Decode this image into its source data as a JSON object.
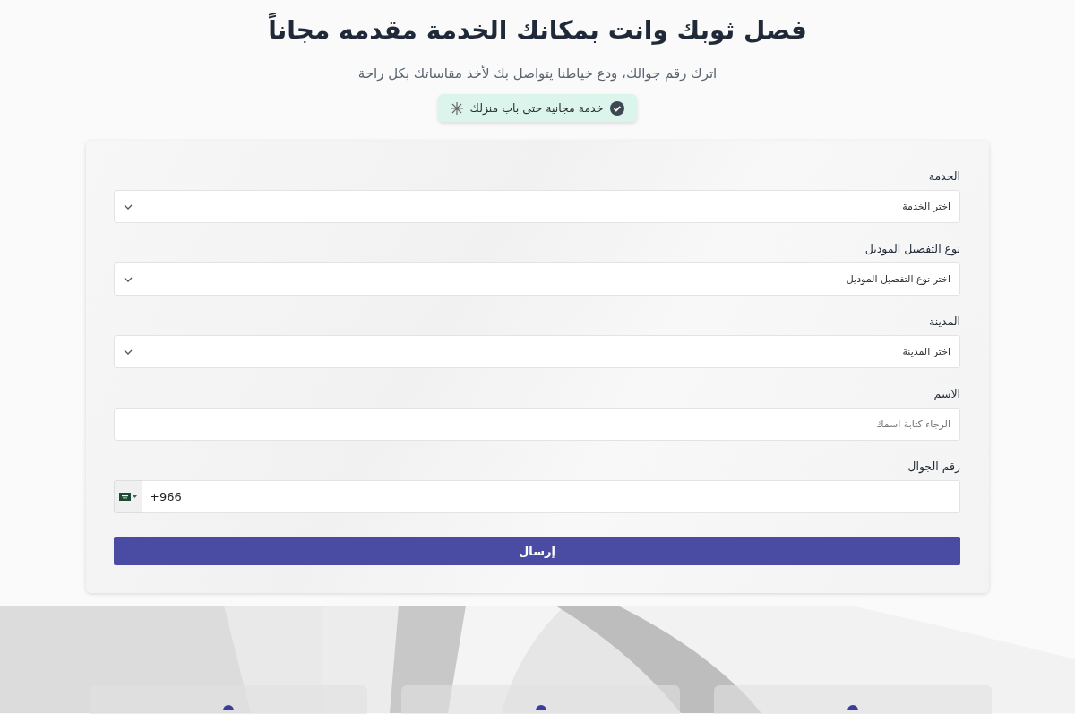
{
  "header": {
    "title": "فصل ثوبك وانت بمكانك الخدمة مقدمه مجاناً",
    "subtitle": "اترك رقم جوالك، ودع خياطنا يتواصل بك لأخذ مقاساتك بكل راحة",
    "badge": "خدمة مجانية حتى باب منزلك"
  },
  "form": {
    "fields": [
      {
        "kind": "select",
        "label": "الخدمة",
        "placeholder": "اختر الخدمة"
      },
      {
        "kind": "select",
        "label": "نوع التفصيل الموديل",
        "placeholder": "اختر نوع التفصيل الموديل"
      },
      {
        "kind": "select",
        "label": "المدينة",
        "placeholder": "اختر المدينة"
      },
      {
        "kind": "text",
        "label": "الاسم",
        "placeholder": "الرجاء كتابة اسمك"
      },
      {
        "kind": "phone",
        "label": "رقم الجوال",
        "value": "+966"
      }
    ],
    "submit": "إرسال"
  }
}
